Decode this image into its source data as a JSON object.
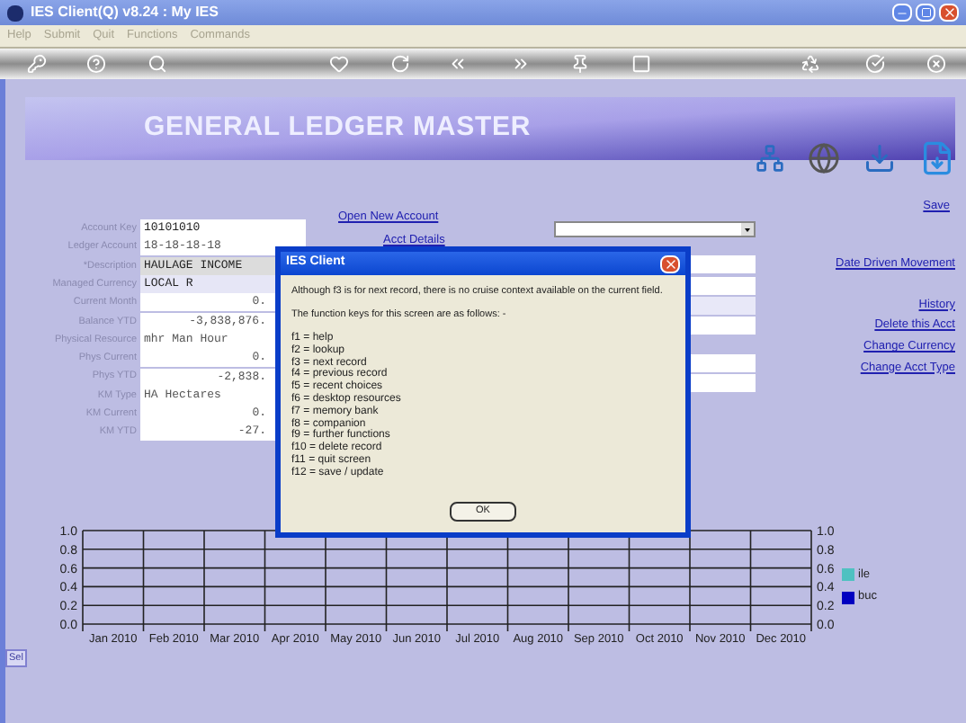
{
  "window": {
    "title": "IES Client(Q) v8.24 : My IES"
  },
  "menu": [
    "Help",
    "Submit",
    "Quit",
    "Functions",
    "Commands"
  ],
  "header": {
    "title": "GENERAL LEDGER MASTER"
  },
  "fields": [
    {
      "label": "Account Key",
      "value": "10101010",
      "kind": "plain"
    },
    {
      "label": "Ledger Account",
      "value": "18-18-18-18",
      "kind": "muted"
    },
    {
      "label": "*Description",
      "value": "HAULAGE INCOME",
      "kind": "shaded"
    },
    {
      "label": "Managed Currency",
      "value": "LOCAL R",
      "kind": "tinted"
    },
    {
      "label": "Current Month",
      "value": "0.",
      "kind": "number"
    },
    {
      "label": "Balance YTD",
      "value": "-3,838,876.",
      "kind": "number"
    },
    {
      "label": "Physical Resource",
      "value": "mhr Man Hour",
      "kind": "muted"
    },
    {
      "label": "Phys Current",
      "value": "0.",
      "kind": "number"
    },
    {
      "label": "Phys YTD",
      "value": "-2,838.",
      "kind": "number"
    },
    {
      "label": "KM Type",
      "value": "HA Hectares",
      "kind": "muted"
    },
    {
      "label": "KM Current",
      "value": "0.",
      "kind": "number"
    },
    {
      "label": "KM YTD",
      "value": "-27.",
      "kind": "number"
    }
  ],
  "middle_links": [
    "Open New Account",
    "Acct Details"
  ],
  "right_links": [
    {
      "label": "Save",
      "kind": "top"
    },
    {
      "label": "Date Driven Movement",
      "kind": "mid"
    },
    {
      "label": "History",
      "kind": "list"
    },
    {
      "label": "Delete this Acct",
      "kind": "list"
    },
    {
      "label": "Change Currency",
      "kind": "list"
    },
    {
      "label": "Change Acct Type",
      "kind": "list"
    }
  ],
  "dialog": {
    "title": "IES Client",
    "message": "Although f3 is for next record, there is no cruise context available on the current field.",
    "intro": "The function keys for this screen are as follows: -",
    "keys": [
      "f1 = help",
      "f2 = lookup",
      "f3 = next record",
      "f4 = previous record",
      "f5 = recent choices",
      "f6 = desktop resources",
      "f7 = memory bank",
      "f8 = companion",
      "f9 = further functions",
      "f10 = delete record",
      "f11 = quit screen",
      "f12 = save / update"
    ],
    "button": "OK"
  },
  "chart": {
    "chart_data": {
      "type": "line",
      "categories": [
        "Jan 2010",
        "Feb 2010",
        "Mar 2010",
        "Apr 2010",
        "May 2010",
        "Jun 2010",
        "Jul 2010",
        "Aug 2010",
        "Sep 2010",
        "Oct 2010",
        "Nov 2010",
        "Dec 2010"
      ],
      "ylim": [
        0,
        1
      ],
      "grid": true,
      "yticks": [
        {
          "value": 0,
          "label": "0.0"
        },
        {
          "value": 0.2,
          "label": "0.2"
        },
        {
          "value": 0.4,
          "label": "0.4"
        },
        {
          "value": 0.6,
          "label": "0.6"
        },
        {
          "value": 0.8,
          "label": "0.8"
        },
        {
          "value": 1,
          "label": "1.0"
        }
      ],
      "series": [
        {
          "name": "ile",
          "color": "#4fc1c1",
          "values": [
            null,
            null,
            null,
            null,
            null,
            null,
            null,
            null,
            null,
            null,
            null,
            null
          ]
        },
        {
          "name": "buc",
          "color": "#0000c0",
          "values": [
            null,
            null,
            null,
            null,
            null,
            null,
            null,
            null,
            null,
            null,
            null,
            null
          ]
        }
      ]
    },
    "right_axis_labels": [
      "1.0",
      "0.8",
      "0.6",
      "0.4",
      "0.2",
      "0.0"
    ]
  },
  "side_tab": "Sel"
}
